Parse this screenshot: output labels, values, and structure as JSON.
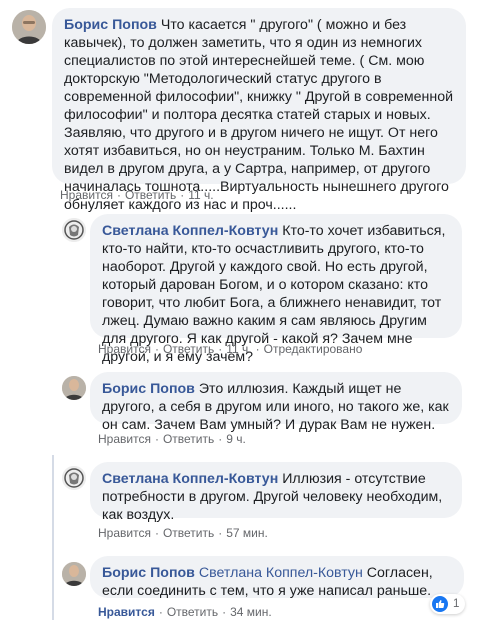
{
  "actions": {
    "like": "Нравится",
    "reply": "Ответить",
    "edited": "Отредактировано",
    "separator": "·"
  },
  "comments": [
    {
      "author": "Борис Попов",
      "text": "Что касается \" другого\" ( можно и без кавычек), то должен заметить, что я один из немногих специалистов по этой интереснейшей теме. ( См. мою докторскую \"Методологический статус другого в современной философии\", книжку \" Другой в современной философии\" и полтора десятка статей старых и новых. Заявляю, что другого и в другом ничего не ищут. От него хотят избавиться, но он неустраним. Только М. Бахтин видел в другом друга, а у Сартра, например, от другого начиналась тошнота.....Виртуальность нынешнего другого обнуляет каждого из нас и проч......",
      "time": "11 ч."
    },
    {
      "author": "Светлана Коппел-Ковтун",
      "text": "Кто-то хочет избавиться, кто-то найти, кто-то осчастливить другого, кто-то наоборот. Другой у каждого свой. Но есть другой, который дарован Богом, и о котором сказано: кто говорит, что любит Бога, а ближнего ненавидит, тот лжец. Думаю важно каким я сам являюсь Другим для другого. Я как другой - какой я? Зачем мне другой, и я ему зачем?",
      "time": "11 ч."
    },
    {
      "author": "Борис Попов",
      "text": "Это иллюзия. Каждый ищет не другого, а себя в другом или иного, но такого же, как он сам. Зачем Вам умный? И дурак Вам не нужен.",
      "time": "9 ч."
    },
    {
      "author": "Светлана Коппел-Ковтун",
      "text": "Иллюзия - отсутствие потребности в другом. Другой человеку необходим, как воздух.",
      "time": "57 мин."
    },
    {
      "author": "Борис Попов",
      "reply_to": "Светлана Коппел-Ковтун",
      "text": "Согласен, если соединить с тем, что я уже написал раньше.",
      "time": "34 мин.",
      "reaction_count": "1"
    }
  ]
}
